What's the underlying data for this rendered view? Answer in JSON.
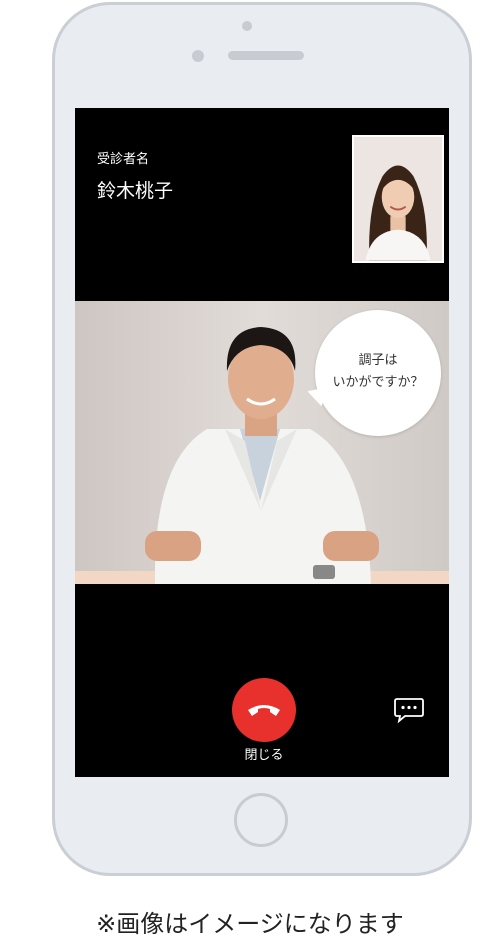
{
  "call": {
    "patient_label": "受診者名",
    "patient_name": "鈴木桃子",
    "bubble_text": "調子は\nいかがですか？",
    "end_call_label": "閉じる"
  },
  "icons": {
    "end_call": "phone-hangup-icon",
    "chat": "chat-bubble-icon"
  },
  "colors": {
    "end_call": "#e8312c",
    "screen_background": "#000000",
    "device_frame": "#e9edf1"
  },
  "note": "※画像はイメージになります"
}
